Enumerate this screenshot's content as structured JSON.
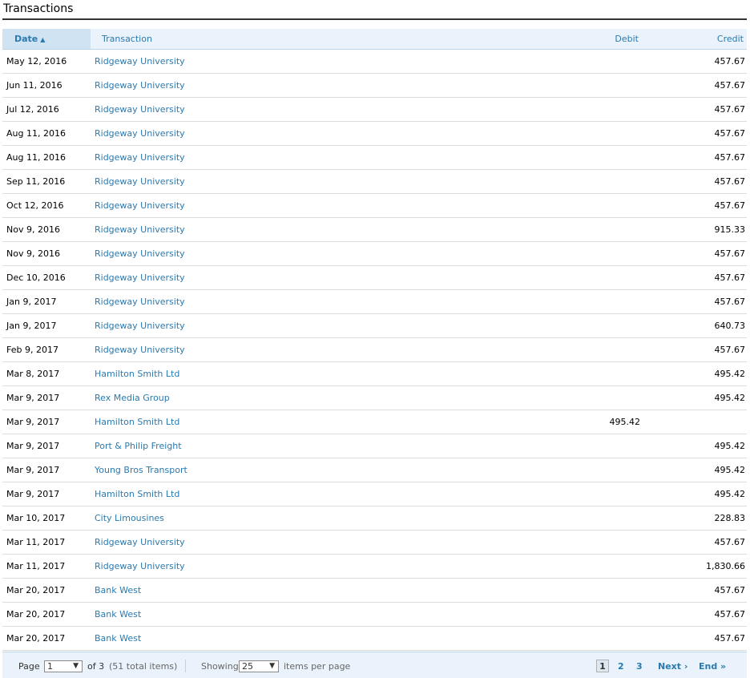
{
  "page_title": "Transactions",
  "columns": {
    "date": "Date",
    "transaction": "Transaction",
    "debit": "Debit",
    "credit": "Credit"
  },
  "rows": [
    {
      "date": "May 12, 2016",
      "transaction": "Ridgeway University",
      "debit": "",
      "credit": "457.67"
    },
    {
      "date": "Jun 11, 2016",
      "transaction": "Ridgeway University",
      "debit": "",
      "credit": "457.67"
    },
    {
      "date": "Jul 12, 2016",
      "transaction": "Ridgeway University",
      "debit": "",
      "credit": "457.67"
    },
    {
      "date": "Aug 11, 2016",
      "transaction": "Ridgeway University",
      "debit": "",
      "credit": "457.67"
    },
    {
      "date": "Aug 11, 2016",
      "transaction": "Ridgeway University",
      "debit": "",
      "credit": "457.67"
    },
    {
      "date": "Sep 11, 2016",
      "transaction": "Ridgeway University",
      "debit": "",
      "credit": "457.67"
    },
    {
      "date": "Oct 12, 2016",
      "transaction": "Ridgeway University",
      "debit": "",
      "credit": "457.67"
    },
    {
      "date": "Nov 9, 2016",
      "transaction": "Ridgeway University",
      "debit": "",
      "credit": "915.33"
    },
    {
      "date": "Nov 9, 2016",
      "transaction": "Ridgeway University",
      "debit": "",
      "credit": "457.67"
    },
    {
      "date": "Dec 10, 2016",
      "transaction": "Ridgeway University",
      "debit": "",
      "credit": "457.67"
    },
    {
      "date": "Jan 9, 2017",
      "transaction": "Ridgeway University",
      "debit": "",
      "credit": "457.67"
    },
    {
      "date": "Jan 9, 2017",
      "transaction": "Ridgeway University",
      "debit": "",
      "credit": "640.73"
    },
    {
      "date": "Feb 9, 2017",
      "transaction": "Ridgeway University",
      "debit": "",
      "credit": "457.67"
    },
    {
      "date": "Mar 8, 2017",
      "transaction": "Hamilton Smith Ltd",
      "debit": "",
      "credit": "495.42"
    },
    {
      "date": "Mar 9, 2017",
      "transaction": "Rex Media Group",
      "debit": "",
      "credit": "495.42"
    },
    {
      "date": "Mar 9, 2017",
      "transaction": "Hamilton Smith Ltd",
      "debit": "495.42",
      "credit": ""
    },
    {
      "date": "Mar 9, 2017",
      "transaction": "Port & Philip Freight",
      "debit": "",
      "credit": "495.42"
    },
    {
      "date": "Mar 9, 2017",
      "transaction": "Young Bros Transport",
      "debit": "",
      "credit": "495.42"
    },
    {
      "date": "Mar 9, 2017",
      "transaction": "Hamilton Smith Ltd",
      "debit": "",
      "credit": "495.42"
    },
    {
      "date": "Mar 10, 2017",
      "transaction": "City Limousines",
      "debit": "",
      "credit": "228.83"
    },
    {
      "date": "Mar 11, 2017",
      "transaction": "Ridgeway University",
      "debit": "",
      "credit": "457.67"
    },
    {
      "date": "Mar 11, 2017",
      "transaction": "Ridgeway University",
      "debit": "",
      "credit": "1,830.66"
    },
    {
      "date": "Mar 20, 2017",
      "transaction": "Bank West",
      "debit": "",
      "credit": "457.67"
    },
    {
      "date": "Mar 20, 2017",
      "transaction": "Bank West",
      "debit": "",
      "credit": "457.67"
    },
    {
      "date": "Mar 20, 2017",
      "transaction": "Bank West",
      "debit": "",
      "credit": "457.67"
    }
  ],
  "pager": {
    "page_label": "Page",
    "page_value": "1",
    "of_label": "of 3",
    "total_items": "(51 total items)",
    "showing_label": "Showing",
    "per_page_value": "25",
    "per_page_label": "items per page",
    "pages": [
      "1",
      "2",
      "3"
    ],
    "next_label": "Next ›",
    "end_label": "End »"
  },
  "colors": {
    "link": "#2a7ab0",
    "header_bg": "#eaf3fb",
    "sorted_header_bg": "#d0e3f3"
  },
  "icons": {
    "sort": "sort-ascending-icon",
    "dropdown": "chevron-down-icon"
  }
}
